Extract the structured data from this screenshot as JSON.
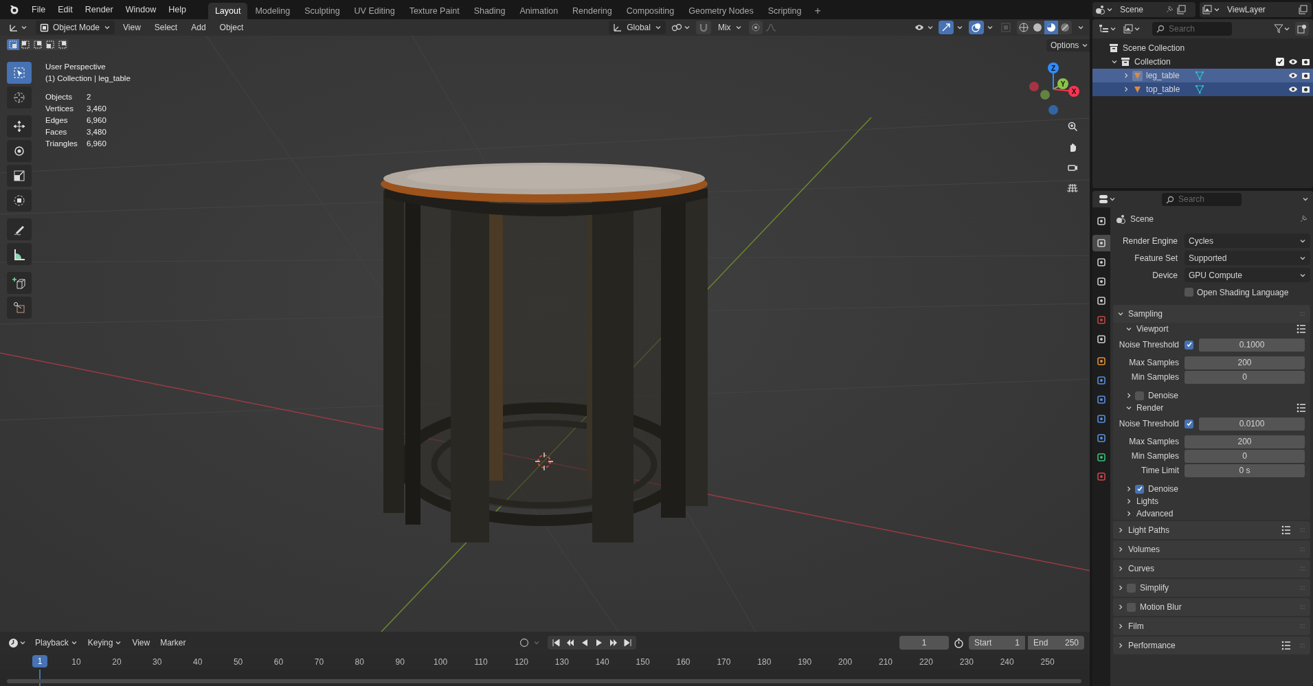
{
  "topbar": {
    "menus": [
      "File",
      "Edit",
      "Render",
      "Window",
      "Help"
    ],
    "workspaces": [
      {
        "label": "Layout",
        "selected": true
      },
      {
        "label": "Modeling",
        "selected": false
      },
      {
        "label": "Sculpting",
        "selected": false
      },
      {
        "label": "UV Editing",
        "selected": false
      },
      {
        "label": "Texture Paint",
        "selected": false
      },
      {
        "label": "Shading",
        "selected": false
      },
      {
        "label": "Animation",
        "selected": false
      },
      {
        "label": "Rendering",
        "selected": false
      },
      {
        "label": "Compositing",
        "selected": false
      },
      {
        "label": "Geometry Nodes",
        "selected": false
      },
      {
        "label": "Scripting",
        "selected": false
      }
    ],
    "add_workspace": "+",
    "scene": "Scene",
    "view_layer": "ViewLayer"
  },
  "viewport_header": {
    "mode": "Object Mode",
    "menus": [
      "View",
      "Select",
      "Add",
      "Object"
    ],
    "orientation": "Global",
    "snap_target": "Mix",
    "options": "Options",
    "select_modes": [
      {
        "selected": true
      },
      {
        "selected": false
      },
      {
        "selected": false
      },
      {
        "selected": false
      },
      {
        "selected": false
      }
    ],
    "shading": [
      {
        "kind": "wireframe",
        "selected": false
      },
      {
        "kind": "solid",
        "selected": false
      },
      {
        "kind": "material",
        "selected": true
      },
      {
        "kind": "rendered",
        "selected": false
      }
    ]
  },
  "viewport": {
    "title": "User Perspective",
    "context": "(1) Collection | leg_table",
    "stats": [
      {
        "label": "Objects",
        "value": "2"
      },
      {
        "label": "Vertices",
        "value": "3,460"
      },
      {
        "label": "Edges",
        "value": "6,960"
      },
      {
        "label": "Faces",
        "value": "3,480"
      },
      {
        "label": "Triangles",
        "value": "6,960"
      }
    ],
    "tools": [
      {
        "kind": "select",
        "selected": true
      },
      {
        "kind": "cursor",
        "selected": false
      },
      {
        "kind": "move",
        "selected": false
      },
      {
        "kind": "rotate",
        "selected": false
      },
      {
        "kind": "scale",
        "selected": false
      },
      {
        "kind": "transform",
        "selected": false
      },
      {
        "kind": "annotate",
        "selected": false
      },
      {
        "kind": "measure",
        "selected": false
      },
      {
        "kind": "add_cube",
        "selected": false
      },
      {
        "kind": "cut",
        "selected": false
      }
    ],
    "gizmo": [
      {
        "label": "Z",
        "color": "#2f8cff"
      },
      {
        "label": "Y",
        "color": "#8bc34a"
      },
      {
        "label": "X",
        "color": "#ff3352"
      }
    ]
  },
  "outliner": {
    "search_placeholder": "Search",
    "tree": [
      {
        "name": "Scene Collection",
        "kind": "scene_collection",
        "children": [
          {
            "name": "Collection",
            "kind": "collection",
            "expanded": true,
            "checked": true,
            "children": [
              {
                "name": "leg_table",
                "kind": "mesh",
                "selected": true,
                "active": true,
                "expanded": false
              },
              {
                "name": "top_table",
                "kind": "mesh",
                "selected": true,
                "active": false,
                "expanded": false
              }
            ]
          }
        ]
      }
    ]
  },
  "properties": {
    "search_placeholder": "Search",
    "context": "Scene",
    "tabs": [
      {
        "kind": "tool",
        "selected": false
      },
      {
        "kind": "render",
        "selected": true
      },
      {
        "kind": "output",
        "selected": false
      },
      {
        "kind": "view_layer",
        "selected": false
      },
      {
        "kind": "scene",
        "selected": false
      },
      {
        "kind": "world",
        "selected": false
      },
      {
        "kind": "collection",
        "selected": false
      },
      {
        "kind": "object",
        "selected": false
      },
      {
        "kind": "modifiers",
        "selected": false
      },
      {
        "kind": "particles",
        "selected": false
      },
      {
        "kind": "physics",
        "selected": false
      },
      {
        "kind": "constraints",
        "selected": false
      },
      {
        "kind": "data",
        "selected": false
      },
      {
        "kind": "material",
        "selected": false
      }
    ],
    "fields": [
      {
        "kind": "dropdown",
        "label": "Render Engine",
        "value": "Cycles"
      },
      {
        "kind": "dropdown",
        "label": "Feature Set",
        "value": "Supported"
      },
      {
        "kind": "dropdown",
        "label": "Device",
        "value": "GPU Compute"
      },
      {
        "kind": "checkbox",
        "label": "Open Shading Language",
        "checked": false
      }
    ],
    "panels": [
      {
        "label": "Sampling",
        "expanded": true,
        "children": [
          {
            "label": "Viewport",
            "expanded": true,
            "presets": true,
            "rows": [
              {
                "kind": "check_number",
                "label": "Noise Threshold",
                "checked": true,
                "value": "0.1000"
              },
              {
                "kind": "number",
                "label": "Max Samples",
                "value": "200"
              },
              {
                "kind": "number",
                "label": "Min Samples",
                "value": "0"
              }
            ]
          },
          {
            "label": "Denoise",
            "expanded": false,
            "checked": false
          },
          {
            "label": "Render",
            "expanded": true,
            "presets": true,
            "rows": [
              {
                "kind": "check_number",
                "label": "Noise Threshold",
                "checked": true,
                "value": "0.0100"
              },
              {
                "kind": "number",
                "label": "Max Samples",
                "value": "200"
              },
              {
                "kind": "number",
                "label": "Min Samples",
                "value": "0"
              },
              {
                "kind": "number",
                "label": "Time Limit",
                "value": "0 s"
              }
            ]
          },
          {
            "label": "Denoise",
            "expanded": false,
            "checked": true
          },
          {
            "label": "Lights",
            "expanded": false
          },
          {
            "label": "Advanced",
            "expanded": false
          }
        ]
      },
      {
        "label": "Light Paths",
        "expanded": false,
        "presets": true
      },
      {
        "label": "Volumes",
        "expanded": false
      },
      {
        "label": "Curves",
        "expanded": false
      },
      {
        "label": "Simplify",
        "expanded": false,
        "checked": false
      },
      {
        "label": "Motion Blur",
        "expanded": false,
        "checked": false
      },
      {
        "label": "Film",
        "expanded": false
      },
      {
        "label": "Performance",
        "expanded": false,
        "presets": true
      }
    ]
  },
  "timeline": {
    "menus": [
      {
        "label": "Playback",
        "dropdown": true
      },
      {
        "label": "Keying",
        "dropdown": true
      },
      {
        "label": "View",
        "dropdown": false
      },
      {
        "label": "Marker",
        "dropdown": false
      }
    ],
    "current_frame": "1",
    "start_label": "Start",
    "start": "1",
    "end_label": "End",
    "end": "250",
    "ruler": [
      "1",
      "10",
      "20",
      "30",
      "40",
      "50",
      "60",
      "70",
      "80",
      "90",
      "100",
      "110",
      "120",
      "130",
      "140",
      "150",
      "160",
      "170",
      "180",
      "190",
      "200",
      "210",
      "220",
      "230",
      "240",
      "250"
    ]
  }
}
